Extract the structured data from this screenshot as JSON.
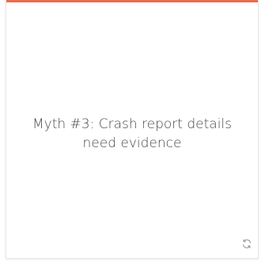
{
  "card": {
    "text_line_1": "Myth #3: Crash report details",
    "text_line_2": "need evidence",
    "accent_color": "#ee6a4a",
    "flip_icon": "refresh-icon"
  }
}
